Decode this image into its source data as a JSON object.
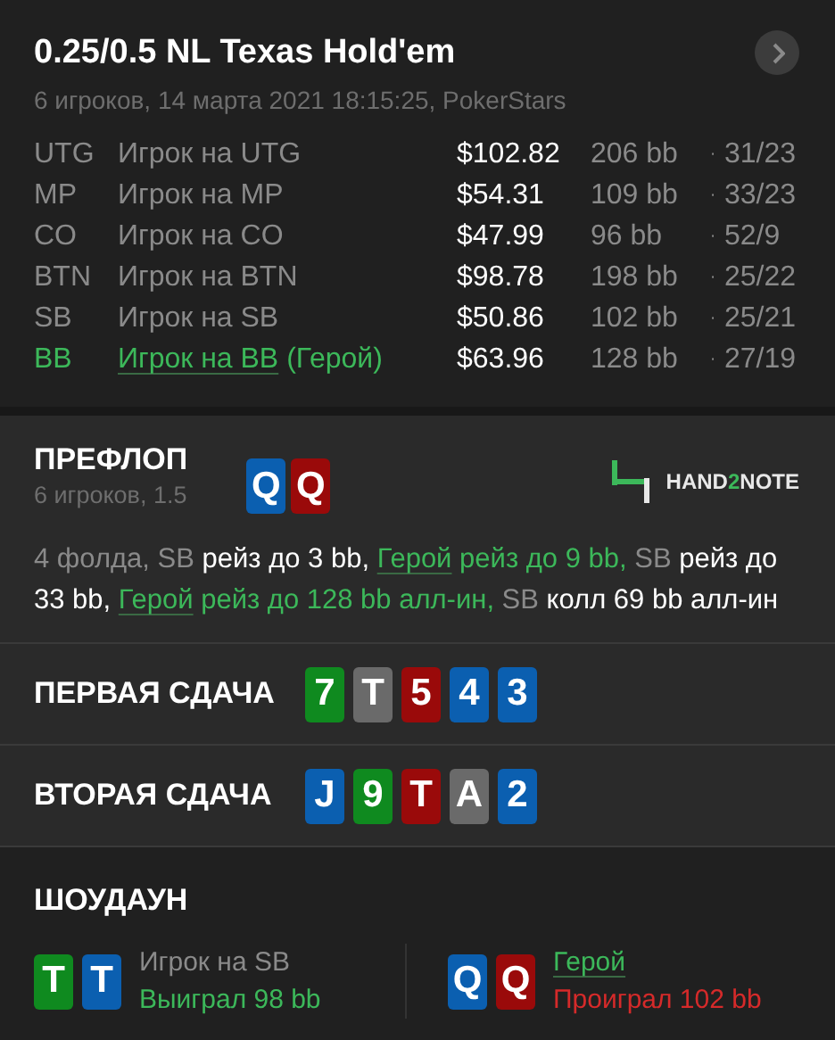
{
  "header": {
    "title": "0.25/0.5 NL Texas Hold'em",
    "subtitle": "6 игроков, 14 марта 2021 18:15:25, PokerStars"
  },
  "players": [
    {
      "position": "UTG",
      "name": "Игрок на UTG",
      "hero": false,
      "stack": "$102.82",
      "bb": "206 bb",
      "separator": "·",
      "stats": "31/23"
    },
    {
      "position": "MP",
      "name": "Игрок на MP",
      "hero": false,
      "stack": "$54.31",
      "bb": "109 bb",
      "separator": "·",
      "stats": "33/23"
    },
    {
      "position": "CO",
      "name": "Игрок на CO",
      "hero": false,
      "stack": "$47.99",
      "bb": "96 bb",
      "separator": "·",
      "stats": "52/9"
    },
    {
      "position": "BTN",
      "name": "Игрок на BTN",
      "hero": false,
      "stack": "$98.78",
      "bb": "198 bb",
      "separator": "·",
      "stats": "25/22"
    },
    {
      "position": "SB",
      "name": "Игрок на SB",
      "hero": false,
      "stack": "$50.86",
      "bb": "102 bb",
      "separator": "·",
      "stats": "25/21"
    },
    {
      "position": "BB",
      "name": "Игрок на BB",
      "hero": true,
      "hero_tag": "(Герой)",
      "stack": "$63.96",
      "bb": "128 bb",
      "separator": "·",
      "stats": "27/19"
    }
  ],
  "preflop": {
    "title": "ПРЕФЛОП",
    "subtitle": "6 игроков, 1.5",
    "cards": [
      {
        "rank": "Q",
        "color": "#0b5fb0"
      },
      {
        "rank": "Q",
        "color": "#9a0a0a"
      }
    ],
    "logo": {
      "text": "HAND",
      "accent": "2",
      "rest": "NOTE"
    },
    "actions": [
      {
        "kind": "muted",
        "text": "4 фолда, SB"
      },
      {
        "kind": "plain",
        "text": " рейз до 3 bb, "
      },
      {
        "kind": "hero-link",
        "text": "Герой"
      },
      {
        "kind": "hero",
        "text": " рейз до 9 bb,"
      },
      {
        "kind": "muted",
        "text": " SB"
      },
      {
        "kind": "plain",
        "text": " рейз до 33 bb, "
      },
      {
        "kind": "hero-link",
        "text": "Герой"
      },
      {
        "kind": "hero",
        "text": " рейз до 128 bb алл-ин,"
      },
      {
        "kind": "muted",
        "text": " SB"
      },
      {
        "kind": "plain",
        "text": " колл 69 bb алл-ин"
      }
    ]
  },
  "boards": [
    {
      "title": "ПЕРВАЯ СДАЧА",
      "cards": [
        {
          "rank": "7",
          "color": "#0f8a1f"
        },
        {
          "rank": "T",
          "color": "#6a6a6a"
        },
        {
          "rank": "5",
          "color": "#9a0a0a"
        },
        {
          "rank": "4",
          "color": "#0b5fb0"
        },
        {
          "rank": "3",
          "color": "#0b5fb0"
        }
      ]
    },
    {
      "title": "ВТОРАЯ СДАЧА",
      "cards": [
        {
          "rank": "J",
          "color": "#0b5fb0"
        },
        {
          "rank": "9",
          "color": "#0f8a1f"
        },
        {
          "rank": "T",
          "color": "#9a0a0a"
        },
        {
          "rank": "A",
          "color": "#6a6a6a"
        },
        {
          "rank": "2",
          "color": "#0b5fb0"
        }
      ]
    }
  ],
  "showdown": {
    "title": "ШОУДАУН",
    "hands": [
      {
        "cards": [
          {
            "rank": "T",
            "color": "#0f8a1f"
          },
          {
            "rank": "T",
            "color": "#0b5fb0"
          }
        ],
        "name": "Игрок на SB",
        "hero": false,
        "won": true,
        "result": "Выиграл 98 bb"
      },
      {
        "cards": [
          {
            "rank": "Q",
            "color": "#0b5fb0"
          },
          {
            "rank": "Q",
            "color": "#9a0a0a"
          }
        ],
        "name": "Герой",
        "hero": true,
        "won": false,
        "result": "Проиграл 102 bb"
      }
    ]
  }
}
